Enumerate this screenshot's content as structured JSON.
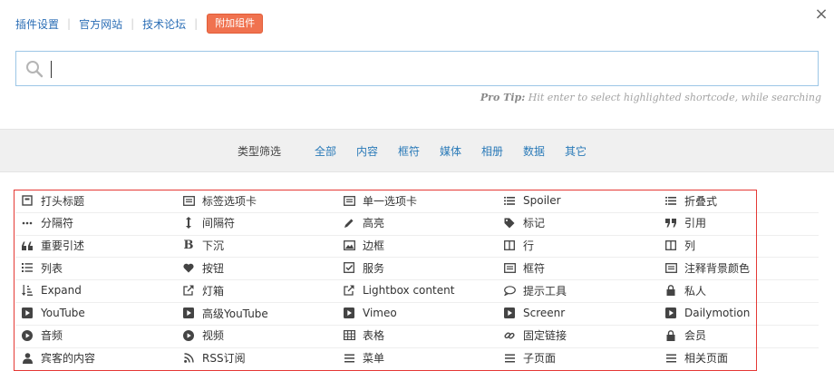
{
  "top_links": {
    "settings": "插件设置",
    "website": "官方网站",
    "forum": "技术论坛",
    "addons": "附加组件"
  },
  "close_symbol": "×",
  "search": {
    "value": "",
    "placeholder": ""
  },
  "tip": {
    "label": "Pro Tip:",
    "text": "Hit enter to select highlighted shortcode, while searching"
  },
  "filter": {
    "label": "类型筛选",
    "items": [
      "全部",
      "内容",
      "框符",
      "媒体",
      "相册",
      "数据",
      "其它"
    ]
  },
  "colors": {
    "link": "#2a6db5",
    "accent": "#f0724f",
    "highlight_border": "#e53935",
    "filter_link": "#2a7ab8"
  },
  "shortcodes": [
    [
      {
        "label": "打头标题",
        "icon": "heading-icon"
      },
      {
        "label": "标签选项卡",
        "icon": "list-alt-icon"
      },
      {
        "label": "单一选项卡",
        "icon": "list-alt-icon"
      },
      {
        "label": "Spoiler",
        "icon": "list-icon"
      },
      {
        "label": "折叠式",
        "icon": "list-icon"
      }
    ],
    [
      {
        "label": "分隔符",
        "icon": "ellipsis-icon"
      },
      {
        "label": "间隔符",
        "icon": "arrows-v-icon"
      },
      {
        "label": "高亮",
        "icon": "pencil-icon"
      },
      {
        "label": "标记",
        "icon": "tag-icon"
      },
      {
        "label": "引用",
        "icon": "quote-right-icon"
      }
    ],
    [
      {
        "label": "重要引述",
        "icon": "quote-left-icon"
      },
      {
        "label": "下沉",
        "icon": "bold-icon"
      },
      {
        "label": "边框",
        "icon": "picture-icon"
      },
      {
        "label": "行",
        "icon": "columns-icon"
      },
      {
        "label": "列",
        "icon": "columns-icon"
      }
    ],
    [
      {
        "label": "列表",
        "icon": "list-ol-icon"
      },
      {
        "label": "按钮",
        "icon": "heart-icon"
      },
      {
        "label": "服务",
        "icon": "check-square-icon"
      },
      {
        "label": "框符",
        "icon": "list-alt-icon"
      },
      {
        "label": "注释背景颜色",
        "icon": "list-alt-icon"
      }
    ],
    [
      {
        "label": "Expand",
        "icon": "sort-amount-icon"
      },
      {
        "label": "灯箱",
        "icon": "external-link-icon"
      },
      {
        "label": "Lightbox content",
        "icon": "external-link-icon"
      },
      {
        "label": "提示工具",
        "icon": "comment-icon"
      },
      {
        "label": "私人",
        "icon": "lock-icon"
      }
    ],
    [
      {
        "label": "YouTube",
        "icon": "play-square-icon"
      },
      {
        "label": "高级YouTube",
        "icon": "play-square-icon"
      },
      {
        "label": "Vimeo",
        "icon": "play-square-icon"
      },
      {
        "label": "Screenr",
        "icon": "play-square-icon"
      },
      {
        "label": "Dailymotion",
        "icon": "play-square-icon"
      }
    ],
    [
      {
        "label": "音频",
        "icon": "play-circle-icon"
      },
      {
        "label": "视频",
        "icon": "play-circle-icon"
      },
      {
        "label": "表格",
        "icon": "table-icon"
      },
      {
        "label": "固定链接",
        "icon": "link-icon"
      },
      {
        "label": "会员",
        "icon": "lock-icon"
      }
    ],
    [
      {
        "label": "宾客的内容",
        "icon": "user-icon"
      },
      {
        "label": "RSS订阅",
        "icon": "rss-icon"
      },
      {
        "label": "菜单",
        "icon": "bars-icon"
      },
      {
        "label": "子页面",
        "icon": "bars-icon"
      },
      {
        "label": "相关页面",
        "icon": "bars-icon"
      }
    ]
  ]
}
